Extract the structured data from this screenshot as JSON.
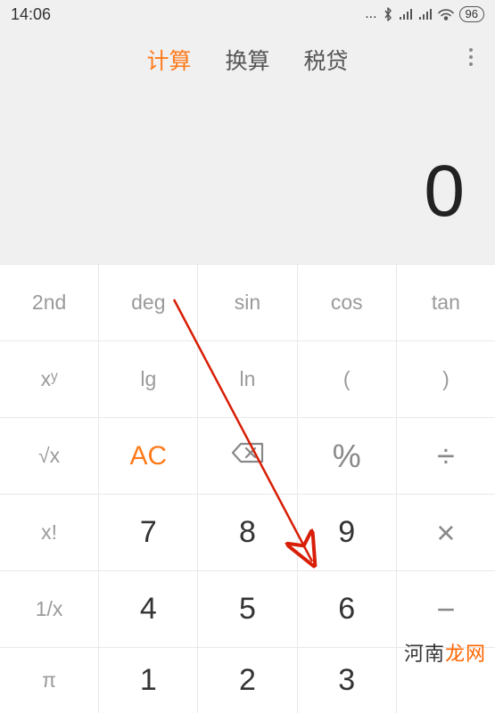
{
  "status": {
    "time": "14:06",
    "battery": "96"
  },
  "tabs": {
    "calc": "计算",
    "convert": "换算",
    "tax": "税贷"
  },
  "display": {
    "value": "0"
  },
  "keys": {
    "r1": {
      "k1": "2nd",
      "k2": "deg",
      "k3": "sin",
      "k4": "cos",
      "k5": "tan"
    },
    "r2": {
      "k1": "xʸ",
      "k2": "lg",
      "k3": "ln",
      "k4": "(",
      "k5": ")"
    },
    "r3": {
      "k1": "√x",
      "k2": "AC",
      "k4": "%",
      "k5": "÷"
    },
    "r4": {
      "k1": "x!",
      "k2": "7",
      "k3": "8",
      "k4": "9",
      "k5": "×"
    },
    "r5": {
      "k1": "1/x",
      "k2": "4",
      "k3": "5",
      "k4": "6",
      "k5": "−"
    },
    "r6": {
      "k1": "π",
      "k2": "1",
      "k3": "2",
      "k4": "3"
    }
  },
  "watermark": {
    "part1": "河南",
    "part2": "龙网"
  }
}
